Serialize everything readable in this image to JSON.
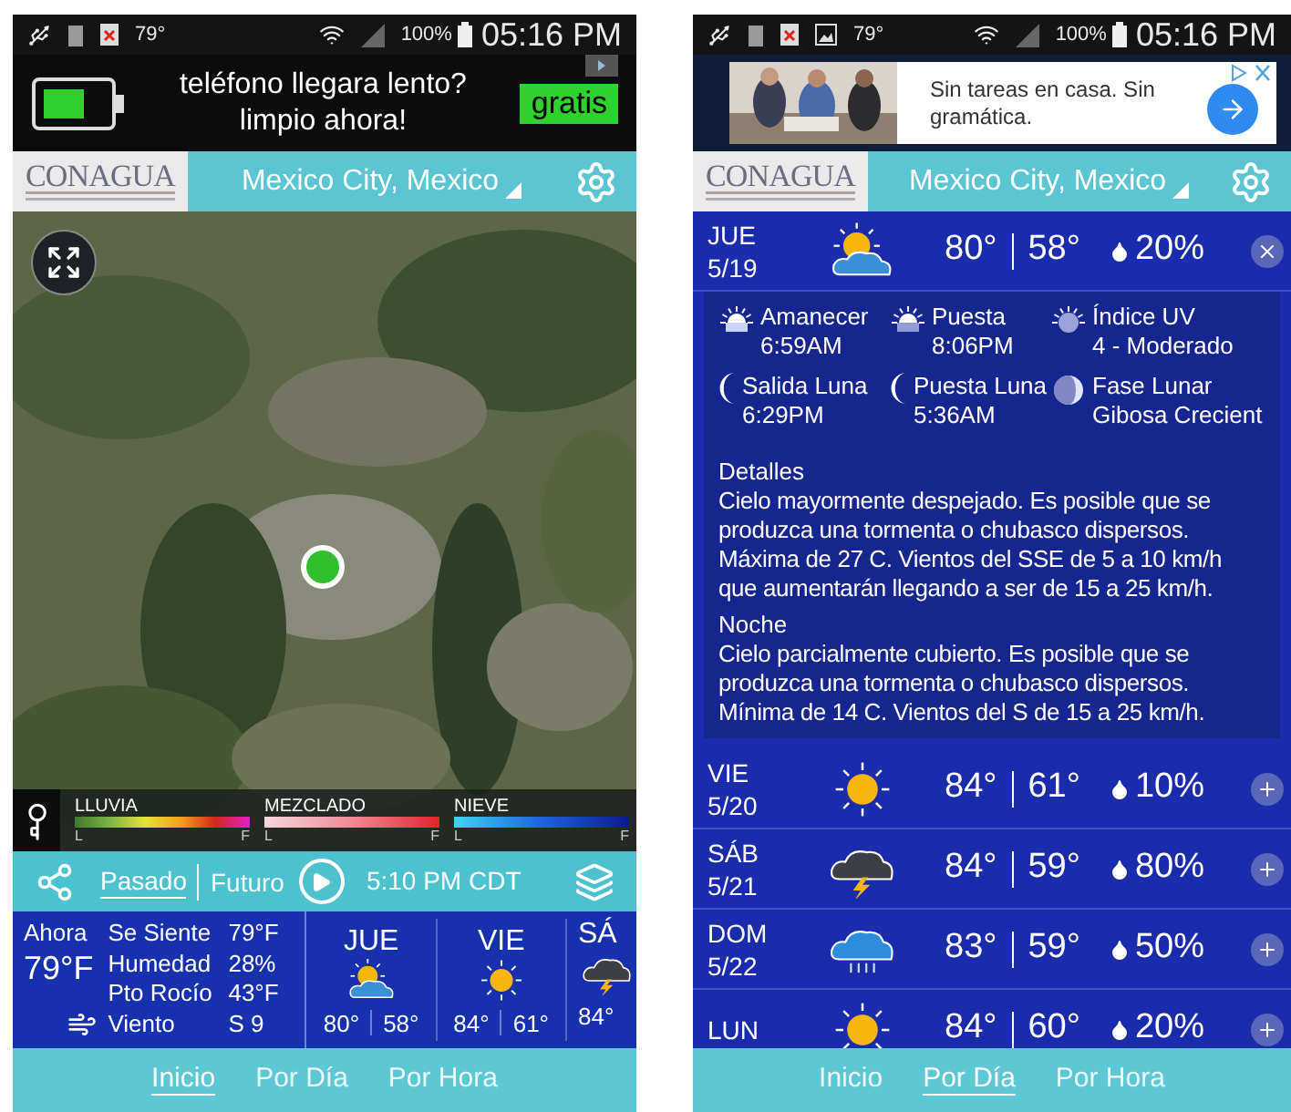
{
  "home_screen": {
    "status_bar": {
      "temperature": "79°",
      "battery": "100%",
      "time": "05:16 PM"
    },
    "ad": {
      "text_lines": [
        "teléfono llegara lento?",
        "limpio ahora!"
      ],
      "button": "gratis"
    },
    "header": {
      "logo": "CONAGUA",
      "location": "Mexico City, Mexico"
    },
    "map": {
      "legend": [
        {
          "kind": "rain",
          "label": "LLUVIA",
          "low": "L",
          "high": "F"
        },
        {
          "kind": "mix",
          "label": "MEZCLADO",
          "low": "L",
          "high": "F"
        },
        {
          "kind": "snow",
          "label": "NIEVE",
          "low": "L",
          "high": "F"
        }
      ]
    },
    "playback": {
      "tabs": [
        {
          "label": "Pasado",
          "selected": true
        },
        {
          "label": "Futuro",
          "selected": false
        }
      ],
      "time": "5:10 PM CDT"
    },
    "current": {
      "label": "Ahora",
      "temperature": "79°F",
      "details": [
        {
          "kind": "plain",
          "label": "Se Siente",
          "value": "79°F"
        },
        {
          "kind": "plain",
          "label": "Humedad",
          "value": "28%"
        },
        {
          "kind": "plain",
          "label": "Pto Rocío",
          "value": "43°F"
        },
        {
          "kind": "wind",
          "label": "Viento",
          "value": "S 9"
        }
      ]
    },
    "forecast": [
      {
        "day": "JUE",
        "kind": "partly_cloudy",
        "high": "80°",
        "low": "58°"
      },
      {
        "day": "VIE",
        "kind": "sunny",
        "high": "84°",
        "low": "61°"
      },
      {
        "day": "SÁ",
        "kind": "storm",
        "high": "84°"
      }
    ],
    "nav": [
      {
        "label": "Inicio",
        "selected": true
      },
      {
        "label": "Por Día",
        "selected": false
      },
      {
        "label": "Por Hora",
        "selected": false
      }
    ]
  },
  "daily_screen": {
    "status_bar": {
      "temperature": "79°",
      "battery": "100%",
      "time": "05:16 PM"
    },
    "ad": {
      "text": "Sin tareas en casa. Sin gramática."
    },
    "header": {
      "logo": "CONAGUA",
      "location": "Mexico City, Mexico"
    },
    "days": [
      {
        "day": "JUE",
        "date": "5/19",
        "kind": "partly_cloudy",
        "high": "80°",
        "low": "58°",
        "precip": "20%",
        "expanded": true
      },
      {
        "day": "VIE",
        "date": "5/20",
        "kind": "sunny",
        "high": "84°",
        "low": "61°",
        "precip": "10%",
        "expanded": false
      },
      {
        "day": "SÁB",
        "date": "5/21",
        "kind": "storm",
        "high": "84°",
        "low": "59°",
        "precip": "80%",
        "expanded": false
      },
      {
        "day": "DOM",
        "date": "5/22",
        "kind": "rain",
        "high": "83°",
        "low": "59°",
        "precip": "50%",
        "expanded": false
      },
      {
        "day": "LUN",
        "kind": "sunny",
        "high": "84°",
        "low": "60°",
        "precip": "20%",
        "expanded": false
      }
    ],
    "details": {
      "astro": [
        {
          "kind": "sunrise",
          "label": "Amanecer",
          "value": "6:59AM"
        },
        {
          "kind": "sunset",
          "label": "Puesta",
          "value": "8:06PM"
        },
        {
          "kind": "uv",
          "label": "Índice UV",
          "value": "4 - Moderado"
        },
        {
          "kind": "moonrise",
          "label": "Salida Luna",
          "value": "6:29PM"
        },
        {
          "kind": "moonset",
          "label": "Puesta Luna",
          "value": "5:36AM"
        },
        {
          "kind": "moon_phase",
          "label": "Fase Lunar",
          "value": "Gibosa Crecient"
        }
      ],
      "sections": [
        {
          "title": "Detalles",
          "text": "Cielo mayormente despejado. Es posible que se produzca una tormenta o chubasco dispersos. Máxima de 27 C. Vientos del SSE de 5 a 10 km/h que aumentarán llegando a ser de 15 a 25 km/h."
        },
        {
          "title": "Noche",
          "text": "Cielo parcialmente cubierto. Es posible que se produzca una tormenta o chubasco dispersos. Mínima de 14 C. Vientos del S de 15 a 25 km/h."
        }
      ]
    },
    "nav": [
      {
        "label": "Inicio",
        "selected": false
      },
      {
        "label": "Por Día",
        "selected": true
      },
      {
        "label": "Por Hora",
        "selected": false
      }
    ]
  }
}
